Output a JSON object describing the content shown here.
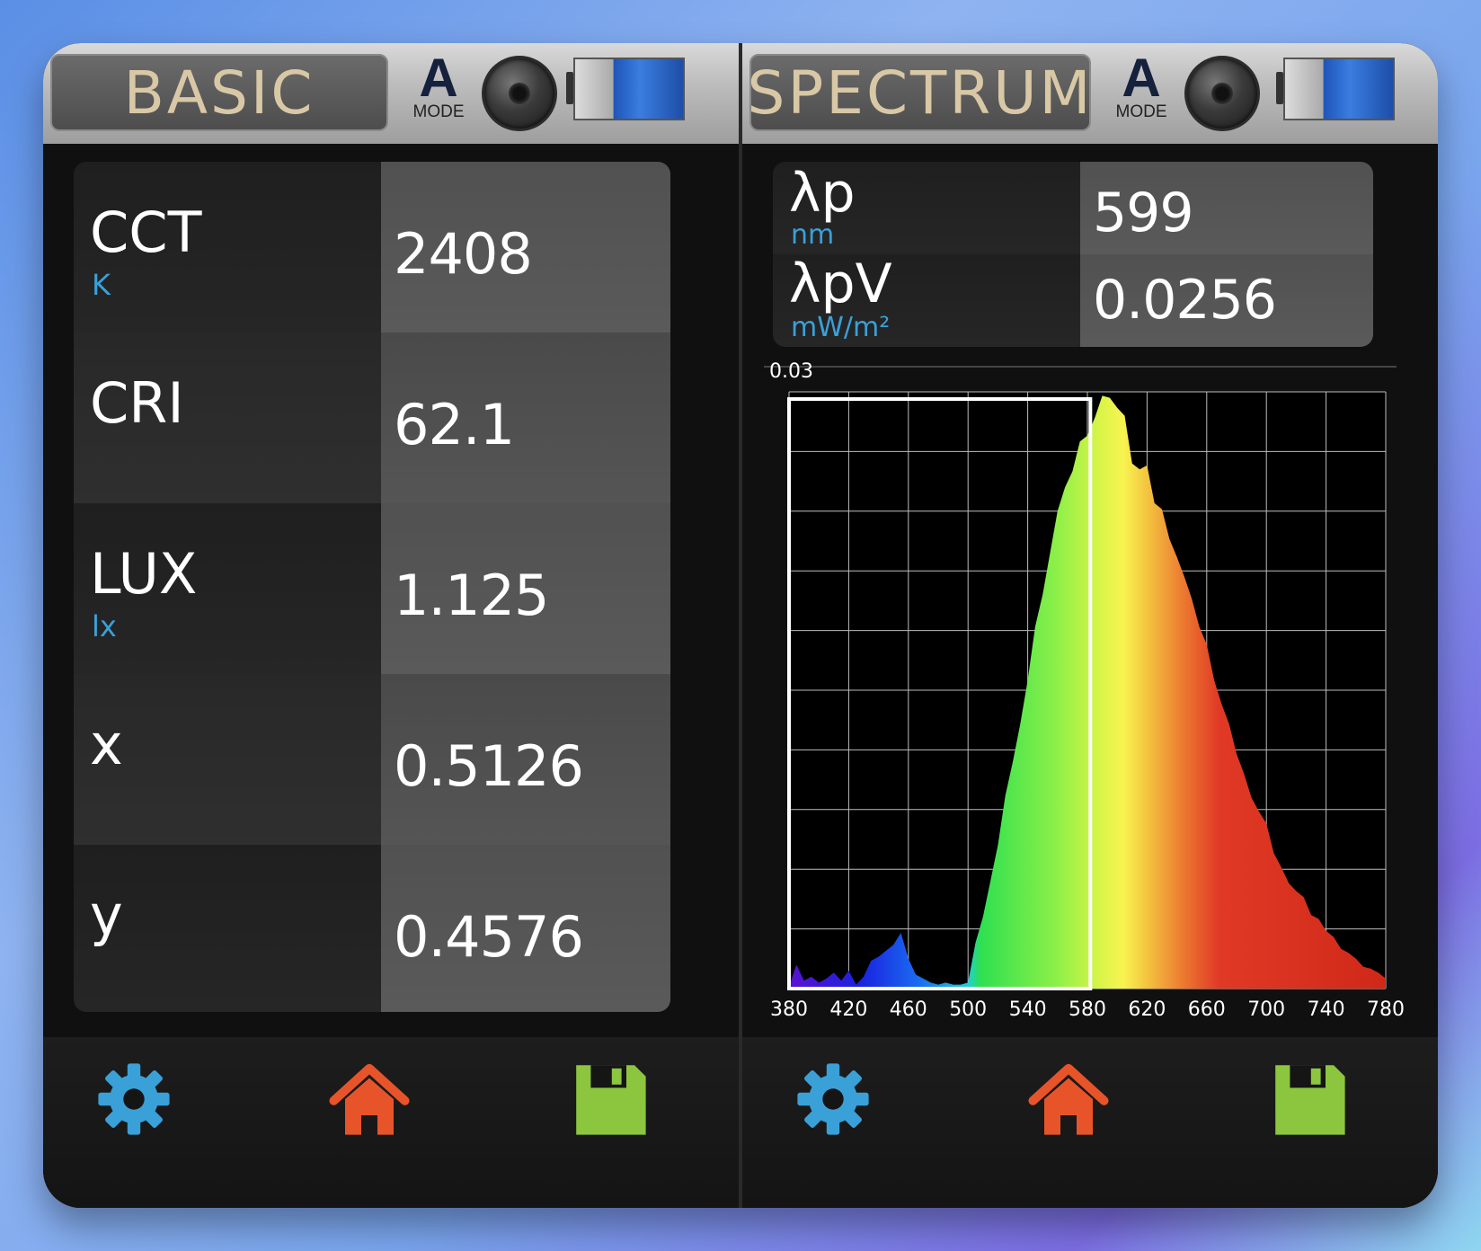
{
  "basic": {
    "title": "BASIC",
    "mode_letter": "A",
    "mode_label": "MODE",
    "rows": [
      {
        "label": "CCT",
        "unit": "K",
        "value": "2408"
      },
      {
        "label": "CRI",
        "unit": "",
        "value": "62.1"
      },
      {
        "label": "LUX",
        "unit": "lx",
        "value": "1.125"
      },
      {
        "label": "x",
        "unit": "",
        "value": "0.5126"
      },
      {
        "label": "y",
        "unit": "",
        "value": "0.4576"
      }
    ]
  },
  "spectrum": {
    "title": "SPECTRUM",
    "mode_letter": "A",
    "mode_label": "MODE",
    "rows": [
      {
        "label": "λp",
        "unit": "nm",
        "value": "599"
      },
      {
        "label": "λpV",
        "unit": "mW/m²",
        "value": "0.0256"
      }
    ]
  },
  "icons": {
    "settings": "gear-icon",
    "home": "home-icon",
    "save": "floppy-disk-icon",
    "shutter": "camera-shutter-icon",
    "battery": "battery-icon"
  },
  "colors": {
    "gear": "#3aa0d8",
    "home": "#e8542a",
    "save": "#8cc63f",
    "unit_text": "#3aa0d8",
    "title_text": "#d9c8a6"
  },
  "chart_data": {
    "type": "area",
    "ymax_label": "0.03",
    "ylim": [
      0,
      0.03
    ],
    "xlim": [
      380,
      780
    ],
    "xticks": [
      380,
      420,
      460,
      500,
      540,
      580,
      620,
      660,
      700,
      740,
      780
    ],
    "grid": true,
    "highlight_range": [
      380,
      582
    ],
    "x": [
      380,
      385,
      390,
      395,
      400,
      405,
      410,
      415,
      420,
      425,
      430,
      435,
      440,
      445,
      450,
      455,
      460,
      465,
      470,
      475,
      480,
      485,
      490,
      495,
      500,
      505,
      510,
      515,
      520,
      525,
      530,
      535,
      540,
      545,
      550,
      555,
      560,
      565,
      570,
      575,
      580,
      585,
      590,
      595,
      600,
      605,
      610,
      615,
      620,
      625,
      630,
      635,
      640,
      645,
      650,
      655,
      660,
      665,
      670,
      675,
      680,
      685,
      690,
      695,
      700,
      705,
      710,
      715,
      720,
      725,
      730,
      735,
      740,
      745,
      750,
      755,
      760,
      765,
      770,
      775,
      780
    ],
    "values": [
      0.0001,
      0.0012,
      0.0004,
      0.0006,
      0.0003,
      0.0005,
      0.0008,
      0.0004,
      0.0009,
      0.0002,
      0.0006,
      0.0014,
      0.0016,
      0.0019,
      0.0022,
      0.0028,
      0.0015,
      0.0007,
      0.0005,
      0.0003,
      0.0002,
      0.0003,
      0.0002,
      0.0002,
      0.0003,
      0.0023,
      0.0036,
      0.0054,
      0.0072,
      0.0097,
      0.0114,
      0.0133,
      0.0155,
      0.0182,
      0.0198,
      0.0219,
      0.024,
      0.0252,
      0.026,
      0.0275,
      0.0278,
      0.0287,
      0.0298,
      0.0297,
      0.0292,
      0.0288,
      0.0264,
      0.0261,
      0.0263,
      0.0244,
      0.0241,
      0.0226,
      0.0217,
      0.0207,
      0.0196,
      0.0182,
      0.0173,
      0.0155,
      0.0143,
      0.0133,
      0.0118,
      0.0108,
      0.0096,
      0.0089,
      0.0083,
      0.0068,
      0.0061,
      0.0053,
      0.0049,
      0.0046,
      0.0037,
      0.0035,
      0.0029,
      0.0026,
      0.002,
      0.0018,
      0.0015,
      0.0011,
      0.001,
      0.0008,
      0.0005
    ]
  }
}
